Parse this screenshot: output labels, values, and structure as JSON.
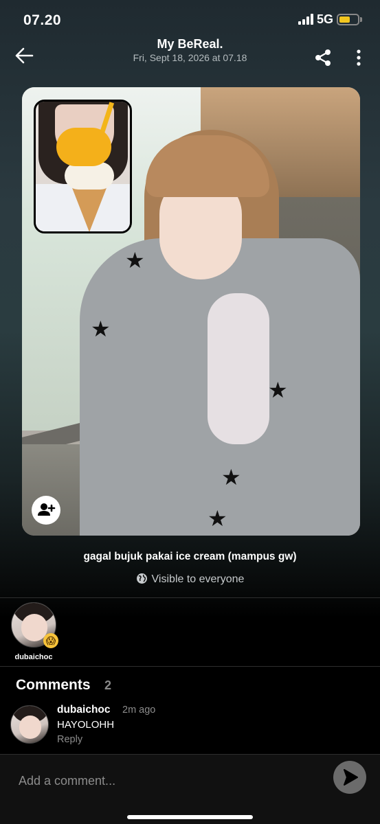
{
  "status_bar": {
    "time": "07.20",
    "network": "5G",
    "battery_level": 0.6,
    "icons": [
      "signal-icon",
      "battery-icon"
    ]
  },
  "header": {
    "title": "My BeReal.",
    "subtitle": "Fri, Sept 18, 2026 at 07.18",
    "icons": [
      "back-arrow-icon",
      "share-icon",
      "more-vertical-icon"
    ]
  },
  "post": {
    "caption": "gagal bujuk pakai ice cream (mampus gw)",
    "visibility": "Visible to everyone",
    "icons": [
      "add-friend-icon",
      "globe-icon"
    ]
  },
  "reactions": [
    {
      "username": "dubaichoc",
      "emoji": "😱"
    }
  ],
  "comments_section": {
    "title": "Comments",
    "count": "2",
    "items": [
      {
        "username": "dubaichoc",
        "time": "2m ago",
        "text": "HAYOLOHH",
        "reply_label": "Reply"
      }
    ]
  },
  "composer": {
    "placeholder": "Add a comment...",
    "icons": [
      "send-icon"
    ]
  },
  "colors": {
    "background": "#000000",
    "battery": "#f2c61f",
    "muted_text": "#8c8c8c",
    "send_button": "#6b6b6b"
  }
}
